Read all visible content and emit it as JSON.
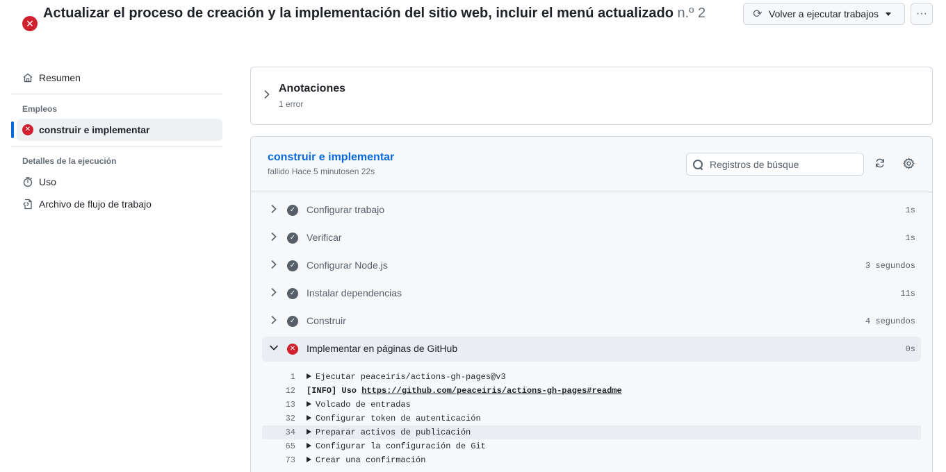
{
  "header": {
    "title": "Actualizar el proceso de creación y la implementación del sitio web, incluir el menú actualizado",
    "run_number": "n.º 2",
    "rerun_label": "Volver a ejecutar trabajos",
    "more_label": "···"
  },
  "sidebar": {
    "summary_label": "Resumen",
    "jobs_heading": "Empleos",
    "active_job": "construir e implementar",
    "details_heading": "Detalles de la ejecución",
    "usage_label": "Uso",
    "workflow_file_label": "Archivo de flujo de trabajo"
  },
  "annotations": {
    "title": "Anotaciones",
    "subtitle": "1 error"
  },
  "job": {
    "title": "construir e implementar",
    "status": "fallido Hace 5 minutosen 22s",
    "search_placeholder": "Registros de búsque",
    "steps": [
      {
        "name": "Configurar trabajo",
        "duration": "1s",
        "status": "success"
      },
      {
        "name": "Verificar",
        "duration": "1s",
        "status": "success"
      },
      {
        "name": "Configurar Node.js",
        "duration": "3 segundos",
        "status": "success"
      },
      {
        "name": "Instalar dependencias",
        "duration": "11s",
        "status": "success"
      },
      {
        "name": "Construir",
        "duration": "4 segundos",
        "status": "success"
      },
      {
        "name": "Implementar en páginas de GitHub",
        "duration": "0s",
        "status": "failure"
      }
    ],
    "log": [
      {
        "num": "1",
        "text": "Ejecutar peaceiris/actions-gh-pages@v3"
      },
      {
        "num": "12",
        "prefix": "[INFO] Uso ",
        "link": "https://github.com/peaceiris/actions-gh-pages#readme"
      },
      {
        "num": "13",
        "text": "Volcado de entradas"
      },
      {
        "num": "32",
        "text": "Configurar token de autenticación"
      },
      {
        "num": "34",
        "text": "Preparar activos de publicación"
      },
      {
        "num": "65",
        "text": "Configurar la configuración de Git"
      },
      {
        "num": "73",
        "text": "Crear una confirmación"
      }
    ]
  },
  "colors": {
    "danger": "#cf222e",
    "accent": "#0969da",
    "muted": "#57606a"
  }
}
